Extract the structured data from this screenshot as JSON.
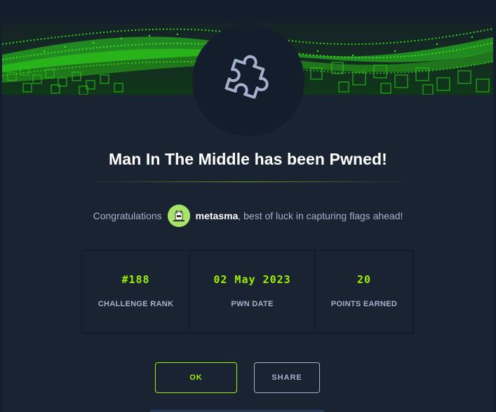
{
  "challenge": {
    "title": "Man In The Middle has been Pwned!",
    "icon": "puzzle-piece-icon"
  },
  "congrats": {
    "prefix": "Congratulations",
    "username": "metasma",
    "suffix": ", best of luck in capturing flags ahead!"
  },
  "stats": [
    {
      "value": "#188",
      "label": "CHALLENGE RANK"
    },
    {
      "value": "02 May 2023",
      "label": "PWN DATE"
    },
    {
      "value": "20",
      "label": "POINTS EARNED"
    }
  ],
  "buttons": {
    "ok_label": "OK",
    "share_label": "SHARE"
  },
  "colors": {
    "accent": "#9fef00",
    "background": "#1a2332",
    "text_muted": "#a4b1cd"
  }
}
